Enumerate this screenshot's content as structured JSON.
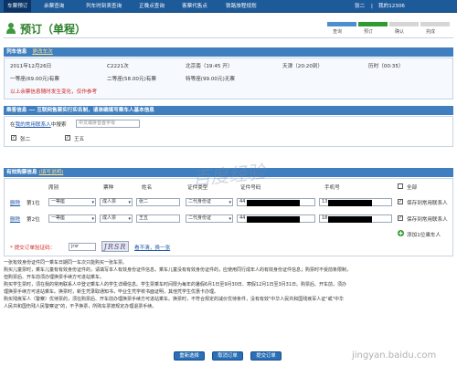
{
  "nav": {
    "items": [
      "车票预订",
      "余票查询",
      "列车时刻表查询",
      "正晚点查询",
      "客票代售点",
      "铁路旅程规划"
    ],
    "user_name": "张二",
    "user_sep": "|",
    "user_hint": "我的12306"
  },
  "header": {
    "title": "预订（单程）",
    "steps": [
      "查询",
      "预订",
      "确认",
      "完成"
    ]
  },
  "train_section": {
    "title": "列车信息",
    "change_link": "更改车次",
    "date": "2011年12月26日",
    "train_no": "C2221次",
    "from": "北京南（19:45 开）",
    "to": "天津（20:20到）",
    "duration": "历时（00:35）",
    "seat_1": "一等座(69.00元)有票",
    "seat_2": "二等座(58.00元)有票",
    "seat_3": "特等座(99.00元)无票",
    "warning": "以上余票信息随时发生变化，仅作参考"
  },
  "passenger_section": {
    "title": "乘客信息 --- 互联网售票实行实名制，请准确填写乘车人基本信息",
    "contacts_label_pre": "在",
    "contacts_link": "我的常用联系人",
    "contacts_label_post": "中搜索",
    "search_placeholder": "中文或拼音首字母",
    "contacts": [
      "张二",
      "王五"
    ]
  },
  "ticket_section": {
    "title": "有效购票信息",
    "title_link": "(填写说明)",
    "headers": [
      "席别",
      "票种",
      "姓名",
      "证件类型",
      "证件号码",
      "手机号",
      "全部"
    ],
    "rows": [
      {
        "delete": "删除",
        "idx": "第1位",
        "seat": "一等座",
        "type": "成人票",
        "name": "张二",
        "id_type": "二代身份证",
        "id_prefix": "44",
        "phone_prefix": "13",
        "save": "保存到常用联系人"
      },
      {
        "delete": "删除",
        "idx": "第2位",
        "seat": "一等座",
        "type": "成人票",
        "name": "王五",
        "id_type": "二代身份证",
        "id_prefix": "44",
        "phone_prefix": "18",
        "save": "保存到常用联系人"
      }
    ],
    "add_passenger": "添加1位乘车人",
    "captcha_label": "* 提交订单验证码：",
    "captcha_value": "jrsr",
    "captcha_image": "JRSR",
    "captcha_refresh": "看不清，换一张"
  },
  "notes": [
    "一张有效身份证件同一乘车日期同一车次只能购买一张车票。",
    "购买儿童票时，乘车儿童有有效身份证件的，请填写本人有效身份证件信息。乘车儿童没有有效身份证件的，应使用同行成年人的有效身份证件信息；购票时不受前条限制，",
    "但购票后、开车前须办理换票手续方可进站乘车。",
    "购买学生票时，须在我的常用联系人中登记乘车人的学生详细信息。学生票乘车时间限为每年的暑假6月1日至9月30日、寒假12月1日至3月31日。购票后、开车前，须办",
    "理换票手续方可进站乘车。换票时，新生凭录取通知书，毕业生凭学校书面证明，其他凭学生优惠卡办理。",
    "购买残疾军人（警察）优待票的，须在购票后、开车前办理换票手续方可进站乘车。换票时，不符合规定的减价优待条件，没有有效\"中华人民共和国残疾军人证\"或\"中华",
    "人民共和国伤残人民警察证\"的，不予换票，所购车票按规定办理退票手续。"
  ],
  "buttons": {
    "reselect": "重新选择",
    "cancel": "取消订单",
    "submit": "提交订单"
  },
  "watermark": {
    "main": "百度经验",
    "site": "jingyan.baidu.com"
  }
}
